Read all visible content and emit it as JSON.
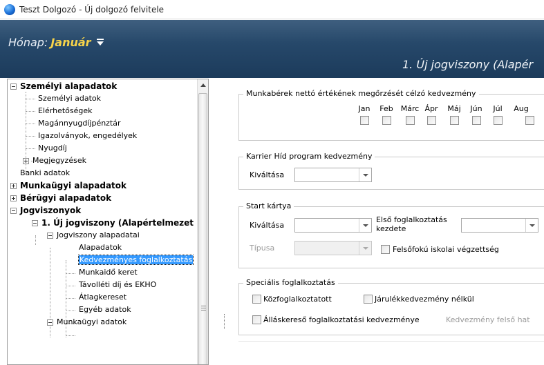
{
  "window": {
    "title": "Teszt Dolgozó - Új dolgozó felvitele"
  },
  "header": {
    "month_label": "Hónap:",
    "month_value": "Január",
    "right_title": "1. Új jogviszony (Alapér"
  },
  "tree": {
    "items": [
      {
        "label": "Személyi alapadatok"
      },
      {
        "label": "Személyi adatok"
      },
      {
        "label": "Elérhetőségek"
      },
      {
        "label": "Magánnyugdíjpénztár"
      },
      {
        "label": "Igazolványok, engedélyek"
      },
      {
        "label": "Nyugdíj"
      },
      {
        "label": "Megjegyzések"
      },
      {
        "label": "Banki adatok"
      },
      {
        "label": "Munkaügyi alapadatok"
      },
      {
        "label": "Bérügyi alapadatok"
      },
      {
        "label": "Jogviszonyok"
      },
      {
        "label": "1. Új jogviszony (Alapértelmezet"
      },
      {
        "label": "Jogviszony alapadatai"
      },
      {
        "label": "Alapadatok"
      },
      {
        "label": "Kedvezményes foglalkoztatás"
      },
      {
        "label": "Munkaidő keret"
      },
      {
        "label": "Távolléti díj és EKHO"
      },
      {
        "label": "Átlagkereset"
      },
      {
        "label": "Egyéb adatok"
      },
      {
        "label": "Munkaügyi adatok"
      }
    ]
  },
  "wage_group": {
    "title": "Munkabérek nettó értékének megőrzését célzó kedvezmény",
    "months": [
      "Jan",
      "Feb",
      "Márc",
      "Ápr",
      "Máj",
      "Jún",
      "Júl",
      "Aug"
    ]
  },
  "karrier_group": {
    "title": "Karrier Híd program kedvezmény",
    "kivaltasa_label": "Kiváltása"
  },
  "start_group": {
    "title": "Start kártya",
    "kivaltasa_label": "Kiváltása",
    "first_employment_label_1": "Első foglalkoztatás",
    "first_employment_label_2": "kezdete",
    "tipus_label": "Típusa",
    "higher_edu_label": "Felsőfokú iskolai végzettség"
  },
  "special_group": {
    "title": "Speciális foglalkoztatás",
    "kozfoglalkoztatott_label": "Közfoglalkoztatott",
    "jarulek_label": "Járulékkedvezmény nélkül",
    "allaskereso_label": "Álláskereső foglalkoztatási kedvezménye",
    "kedvezmeny_felso_label": "Kedvezmény felső hat"
  }
}
